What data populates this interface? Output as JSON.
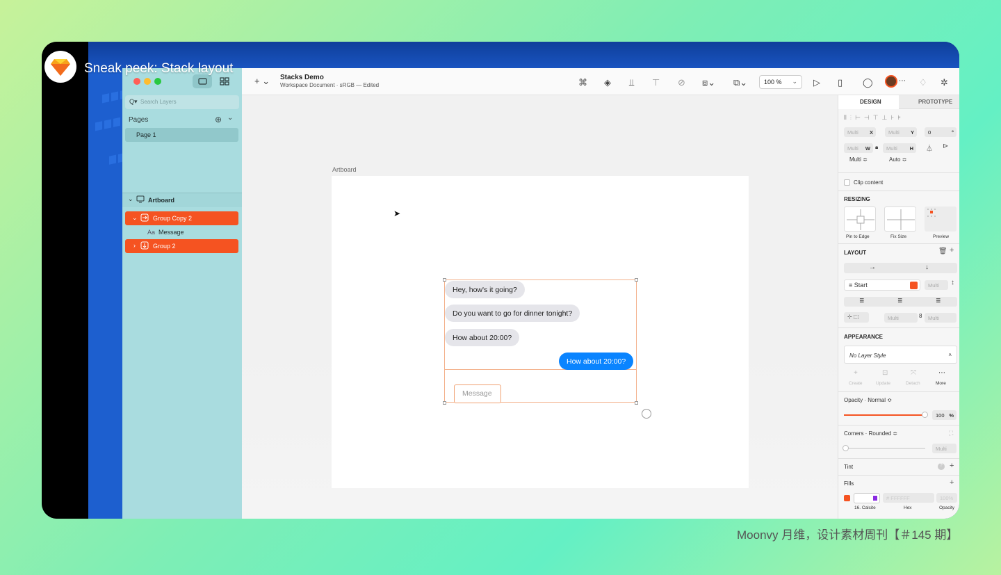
{
  "video": {
    "title": "Sneak peek: Stack layout"
  },
  "caption": "Moonvy 月维，设计素材周刊【＃145 期】",
  "window": {
    "doc_title": "Stacks Demo",
    "doc_subtitle": "Workspace Document · sRGB — Edited",
    "zoom": "100 %"
  },
  "sidebar": {
    "search_placeholder": "Search Layers",
    "pages_header": "Pages",
    "pages": [
      "Page 1"
    ],
    "layers": {
      "artboard": "Artboard",
      "group_copy": "Group Copy 2",
      "message": "Message",
      "group2": "Group 2",
      "message_prefix": "Aa"
    }
  },
  "canvas": {
    "artboard_label": "Artboard",
    "bubbles": [
      "Hey, how's it going?",
      "Do you want to go for dinner tonight?",
      "How about 20:00?",
      "How about 20:00?"
    ],
    "message_placeholder": "Message"
  },
  "inspector": {
    "tab_design": "DESIGN",
    "tab_prototype": "PROTOTYPE",
    "x_label": "X",
    "y_label": "Y",
    "w_label": "W",
    "h_label": "H",
    "multi": "Multi",
    "rot": "0",
    "rot_unit": "°",
    "multi_sel": "Multi ≎",
    "auto_sel": "Auto ≎",
    "clip": "Clip content",
    "resizing": "RESIZING",
    "pin": "Pin to Edge",
    "fix": "Fix Size",
    "preview": "Preview",
    "layout": "LAYOUT",
    "start": "Start",
    "appearance": "APPEARANCE",
    "style": "No Layer Style",
    "create": "Create",
    "update": "Update",
    "detach": "Detach",
    "more": "More",
    "opacity": "Opacity · Normal ≎",
    "opacity_val": "100",
    "opacity_unit": "%",
    "opacity_fraction": 1.0,
    "corners": "Corners · Rounded ≎",
    "tint": "Tint",
    "fills": "Fills",
    "fill_color": "16. Calcite",
    "hex_label": "Hex",
    "opacity_label": "Opacity",
    "hex_val": "# FFFFFF",
    "fill_opacity": "100%"
  },
  "colors": {
    "accent": "#f55321",
    "blue": "#0a84ff",
    "sidebar": "#a9dcdf"
  }
}
